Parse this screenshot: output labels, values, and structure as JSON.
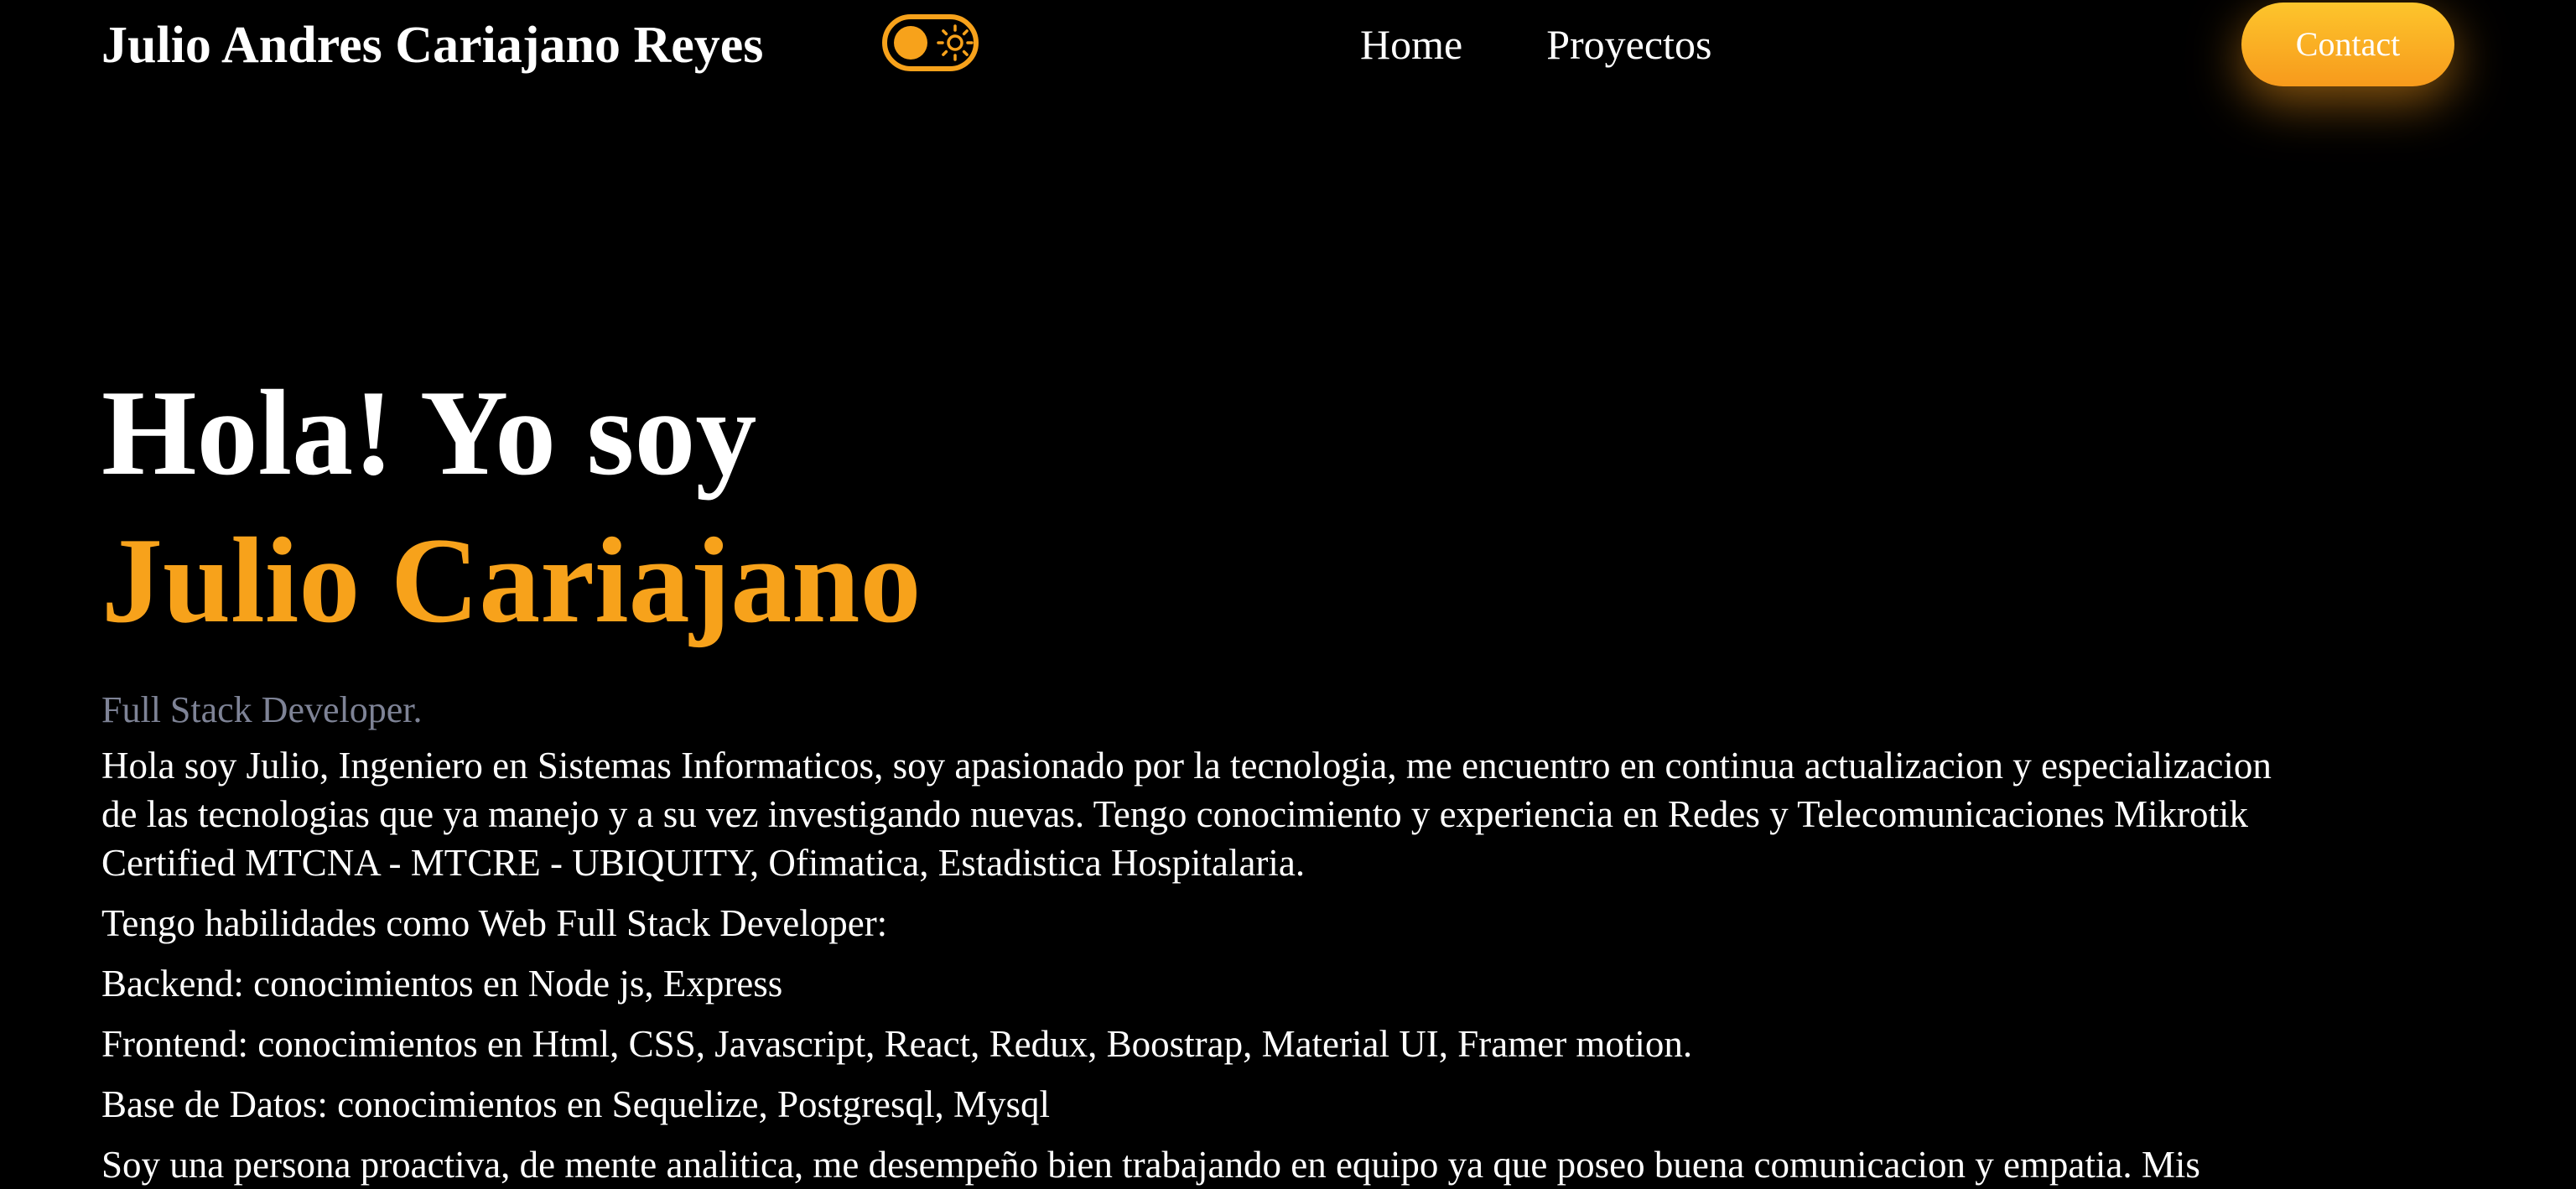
{
  "header": {
    "brand": "Julio Andres Cariajano Reyes",
    "theme_toggle_icon": "sun-icon",
    "nav": [
      {
        "label": "Home"
      },
      {
        "label": "Proyectos"
      }
    ],
    "contact_label": "Contact"
  },
  "hero": {
    "greeting": "Hola! Yo soy",
    "name": "Julio Cariajano",
    "role": "Full Stack Developer.",
    "intro": "Hola soy Julio, Ingeniero en Sistemas Informaticos, soy apasionado por la tecnologia, me encuentro en continua actualizacion y especializacion de las tecnologias que ya manejo y a su vez investigando nuevas. Tengo conocimiento y experiencia en Redes y Telecomunicaciones Mikrotik Certified MTCNA - MTCRE - UBIQUITY, Ofimatica, Estadistica Hospitalaria.",
    "skills_heading": "Tengo habilidades como Web Full Stack Developer:",
    "backend": "Backend: conocimientos en Node js, Express",
    "frontend": "Frontend: conocimientos en Html, CSS, Javascript, React, Redux, Boostrap, Material UI, Framer motion.",
    "database": "Base de Datos: conocimientos en Sequelize, Postgresql, Mysql",
    "closing": "Soy una persona proactiva, de mente analitica, me desempeño bien trabajando en equipo ya que poseo buena comunicacion y empatia. Mis"
  },
  "colors": {
    "background": "#000000",
    "accent": "#f7a21b",
    "muted": "#7e8396",
    "text": "#ffffff"
  }
}
